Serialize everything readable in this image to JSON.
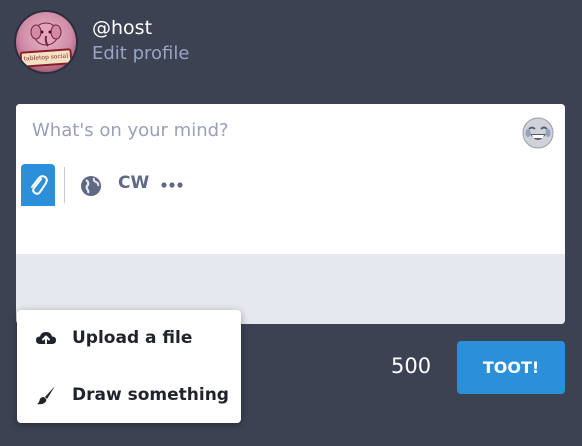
{
  "profile": {
    "handle": "@host",
    "edit_label": "Edit profile",
    "avatar_ribbon_text": "tabletop social"
  },
  "composer": {
    "placeholder": "What's on your mind?",
    "emoji_icon": "grinning-face-with-tears-icon",
    "toolbar": {
      "attach_icon": "paperclip-icon",
      "privacy_icon": "globe-icon",
      "cw_label": "CW",
      "more_icon": "ellipsis-icon"
    }
  },
  "submit": {
    "char_count": "500",
    "button_label": "TOOT!"
  },
  "attach_menu": {
    "items": [
      {
        "label": "Upload a file",
        "icon": "cloud-upload-icon"
      },
      {
        "label": "Draw something",
        "icon": "paintbrush-icon"
      }
    ]
  },
  "colors": {
    "background": "#3d4253",
    "accent": "#2b90d9",
    "toolbar": "#e6e8ef",
    "muted_text": "#9aa3c4"
  }
}
